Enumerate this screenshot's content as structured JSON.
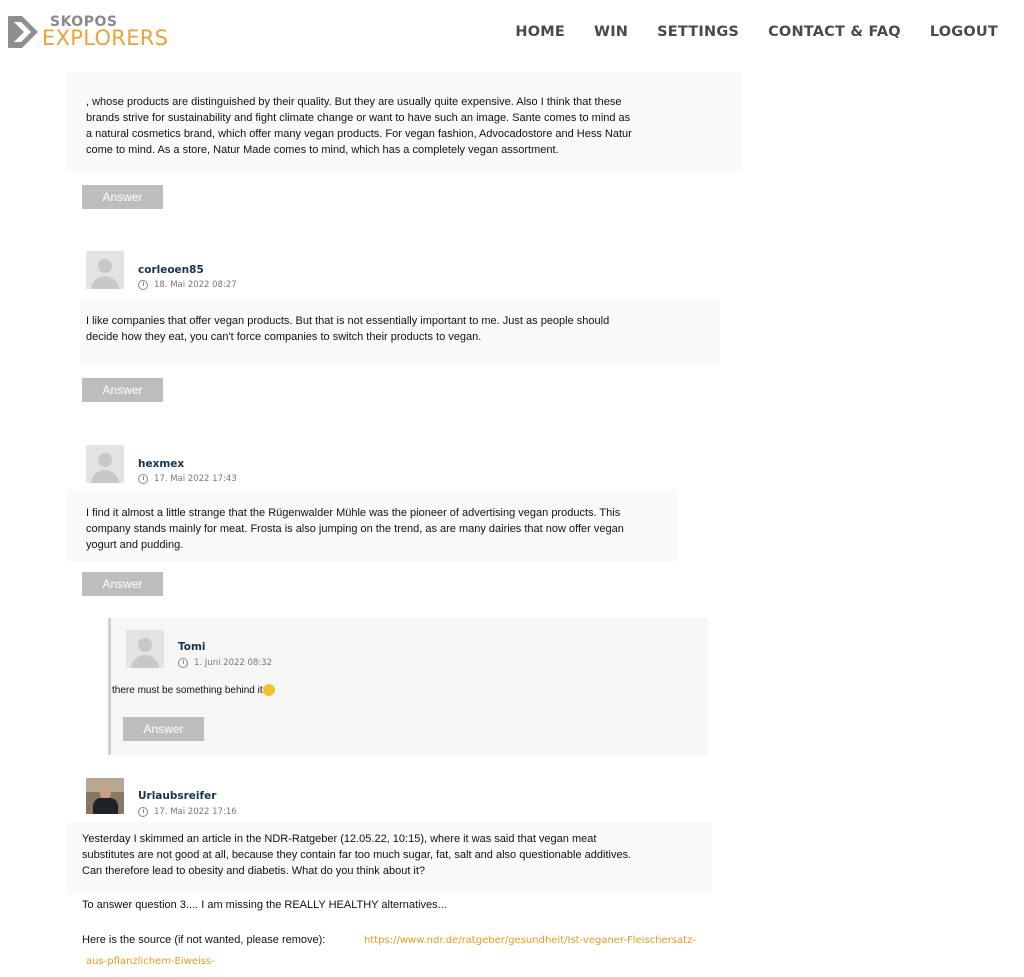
{
  "header": {
    "logo_top": "SKOPOS",
    "logo_bottom": "EXPLORERS",
    "nav": [
      "HOME",
      "WIN",
      "SETTINGS",
      "CONTACT & FAQ",
      "LOGOUT"
    ]
  },
  "answer_label": "Answer",
  "comments": [
    {
      "lines": [
        ", whose products are distinguished by their quality. But they are usually quite expensive. Also I think that these",
        "brands strive for sustainability and fight climate change or want to have such an image. Sante comes to mind as",
        "a natural cosmetics brand, which offer many vegan products. For vegan fashion, Advocadostore and Hess Natur",
        "come to mind. As a store, Natur Made comes to mind, which has a completely vegan assortment."
      ]
    },
    {
      "user": "corleoen85",
      "date": "18. Mai 2022 08:27",
      "lines": [
        "I like companies that offer vegan products. But that is not essentially important to me. Just as people should",
        "decide how they eat, you can't force companies to switch their products to vegan."
      ]
    },
    {
      "user": "hexmex",
      "date": "17. Mai 2022 17:43",
      "lines": [
        "I find it almost a little strange that the Rügenwalder Mühle was the pioneer of advertising vegan products. This",
        "company stands mainly for meat. Frosta is also jumping on the trend, as are many dairies that now offer vegan",
        "yogurt and pudding."
      ]
    },
    {
      "user": "Tomi",
      "date": "1. Juni 2022 08:32",
      "text": "there must be something behind it"
    },
    {
      "user": "Urlaubsreifer",
      "date": "17. Mai 2022 17:16",
      "lines": [
        "Yesterday I skimmed an article in the NDR-Ratgeber (12.05.22, 10:15), where it was said that vegan meat",
        "substitutes are not good at all, because they contain far too much sugar, fat, salt and also questionable additives.",
        "Can therefore lead to obesity and diabetis. What do you think about it?"
      ],
      "line2": "To answer question 3.... I am missing the REALLY HEALTHY alternatives...",
      "source_label": "Here is the source (if not wanted, please remove):",
      "source_link_1": "https://www.ndr.de/ratgeber/gesundheit/Ist-veganer-Fleischersatz-",
      "source_link_2": "aus-pflanzlichem-Eiweiss-"
    }
  ],
  "colors": {
    "brand_orange": "#e8a33d",
    "nav_text": "#4a4a4a",
    "button_bg": "#bdbdbd",
    "username": "#17344f",
    "link": "#e39a20"
  }
}
